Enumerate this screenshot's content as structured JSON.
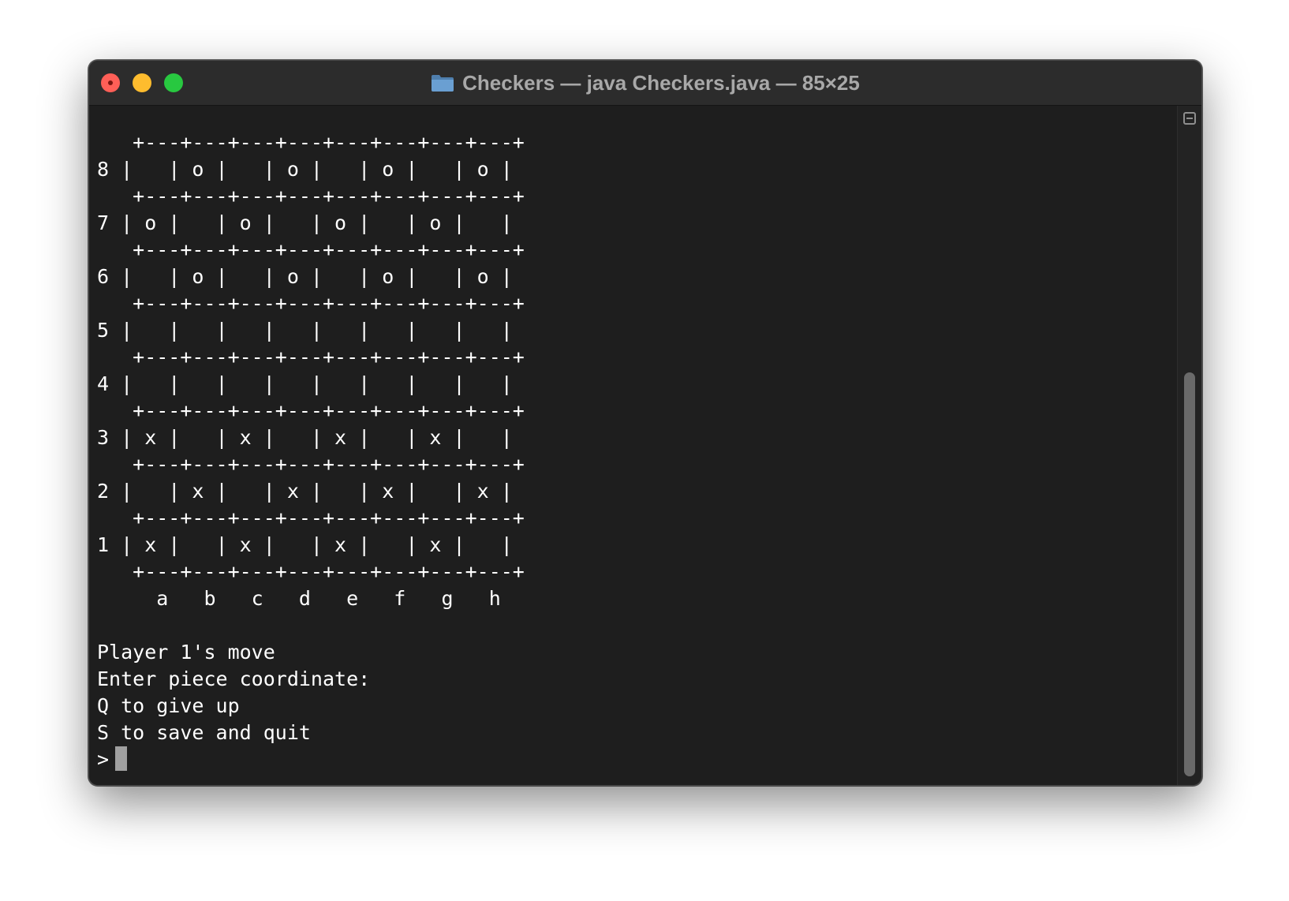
{
  "window": {
    "title": "Checkers — java Checkers.java — 85×25",
    "title_icon": "folder-icon"
  },
  "terminal": {
    "board_lines": [
      "   +---+---+---+---+---+---+---+---+",
      "8 |   | o |   | o |   | o |   | o |",
      "   +---+---+---+---+---+---+---+---+",
      "7 | o |   | o |   | o |   | o |   |",
      "   +---+---+---+---+---+---+---+---+",
      "6 |   | o |   | o |   | o |   | o |",
      "   +---+---+---+---+---+---+---+---+",
      "5 |   |   |   |   |   |   |   |   |",
      "   +---+---+---+---+---+---+---+---+",
      "4 |   |   |   |   |   |   |   |   |",
      "   +---+---+---+---+---+---+---+---+",
      "3 | x |   | x |   | x |   | x |   |",
      "   +---+---+---+---+---+---+---+---+",
      "2 |   | x |   | x |   | x |   | x |",
      "   +---+---+---+---+---+---+---+---+",
      "1 | x |   | x |   | x |   | x |   |",
      "   +---+---+---+---+---+---+---+---+",
      "     a   b   c   d   e   f   g   h"
    ],
    "messages": [
      "Player 1's move",
      "Enter piece coordinate:",
      "Q to give up",
      "S to save and quit"
    ],
    "prompt": ">"
  },
  "colors": {
    "background": "#1e1e1e",
    "text": "#ffffff",
    "titlebar": "#2c2c2c",
    "close": "#ff5f57",
    "minimize": "#febc2e",
    "maximize": "#28c840"
  }
}
